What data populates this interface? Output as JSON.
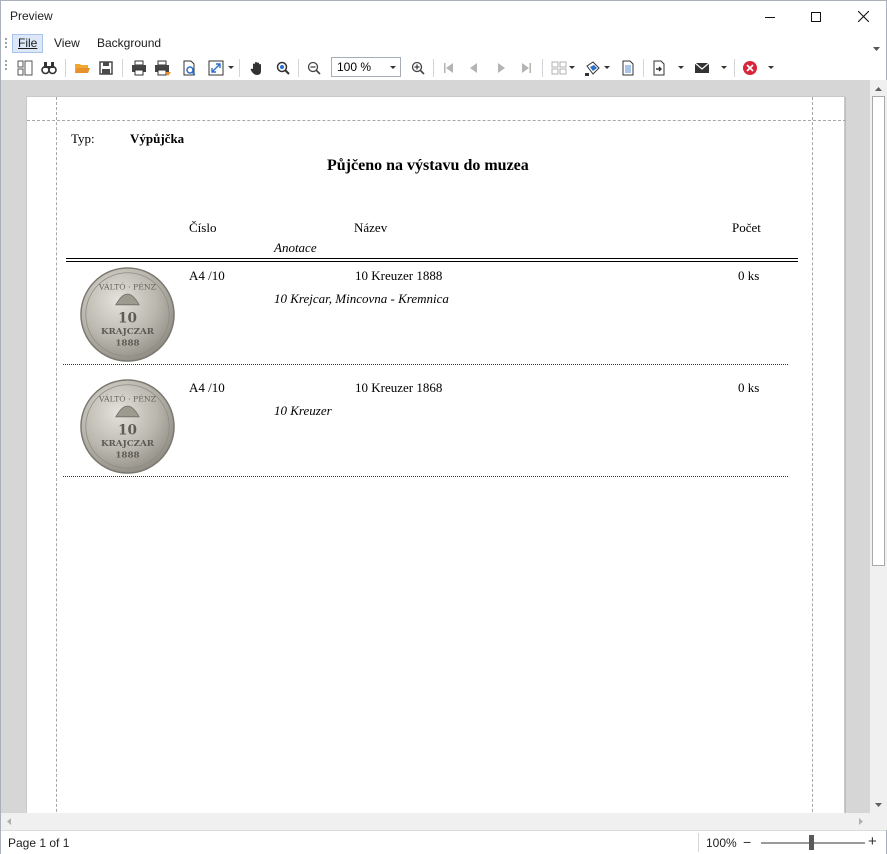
{
  "window": {
    "title": "Preview",
    "controls": [
      "minimize-icon",
      "maximize-icon",
      "close-icon"
    ]
  },
  "menu": {
    "file": "File",
    "view": "View",
    "background": "Background"
  },
  "toolbar": {
    "zoom_value": "100 %",
    "icons": [
      "thumbnails-icon",
      "binoculars-icon",
      "open-folder-icon",
      "save-icon",
      "print-icon",
      "quick-print-icon",
      "page-setup-icon",
      "scale-icon",
      "hand-tool-icon",
      "magnifier-icon",
      "zoom-out-icon",
      "zoom-in-icon",
      "first-page-icon",
      "previous-page-icon",
      "next-page-icon",
      "last-page-icon",
      "multiple-pages-icon",
      "fill-background-icon",
      "watermark-icon",
      "export-icon",
      "email-icon",
      "close-preview-icon"
    ]
  },
  "report": {
    "type_label": "Typ:",
    "type_value": "Výpůjčka",
    "title": "Půjčeno na výstavu do muzea",
    "headers": {
      "number": "Číslo",
      "name": "Název",
      "count": "Počet",
      "annotation": "Anotace"
    },
    "rows": [
      {
        "number": "A4 /10",
        "name": "10 Kreuzer 1888",
        "count": "0 ks",
        "annotation": "10 Krejcar, Mincovna - Kremnica",
        "coin_legend_top": "VÁLTÓ · PÉNZ",
        "coin_value": "10",
        "coin_word": "KRAJCZAR",
        "coin_year": "1888"
      },
      {
        "number": "A4 /10",
        "name": "10 Kreuzer 1868",
        "count": "0 ks",
        "annotation": "10 Kreuzer",
        "coin_legend_top": "VÁLTÓ · PÉNZ",
        "coin_value": "10",
        "coin_word": "KRAJCZAR",
        "coin_year": "1888"
      }
    ]
  },
  "status": {
    "page_info": "Page 1 of 1",
    "zoom": "100%",
    "zoom_level_percent": 100
  }
}
